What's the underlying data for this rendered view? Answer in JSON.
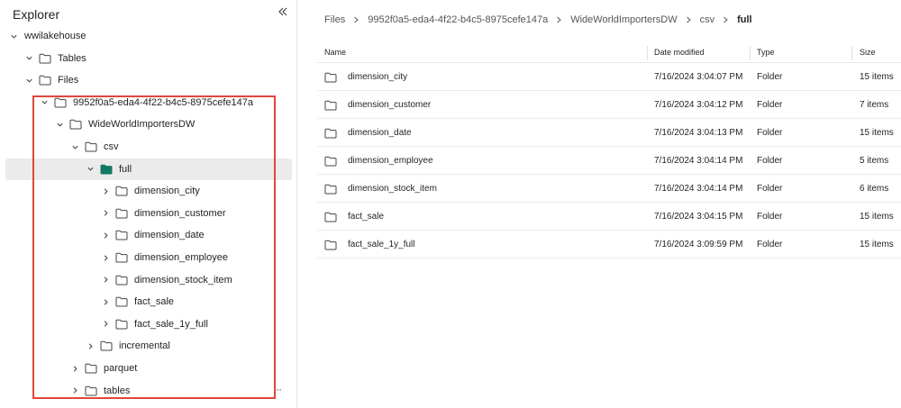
{
  "explorer": {
    "title": "Explorer",
    "tree": [
      {
        "label": "wwilakehouse",
        "depth": 0,
        "expanded": true,
        "folder": false
      },
      {
        "label": "Tables",
        "depth": 1,
        "expanded": true,
        "folder": true
      },
      {
        "label": "Files",
        "depth": 1,
        "expanded": true,
        "folder": true
      },
      {
        "label": "9952f0a5-eda4-4f22-b4c5-8975cefe147a",
        "depth": 2,
        "expanded": true,
        "folder": true
      },
      {
        "label": "WideWorldImportersDW",
        "depth": 3,
        "expanded": true,
        "folder": true
      },
      {
        "label": "csv",
        "depth": 4,
        "expanded": true,
        "folder": true
      },
      {
        "label": "full",
        "depth": 5,
        "expanded": true,
        "folder": true,
        "selected": true
      },
      {
        "label": "dimension_city",
        "depth": 6,
        "expanded": false,
        "folder": true
      },
      {
        "label": "dimension_customer",
        "depth": 6,
        "expanded": false,
        "folder": true
      },
      {
        "label": "dimension_date",
        "depth": 6,
        "expanded": false,
        "folder": true
      },
      {
        "label": "dimension_employee",
        "depth": 6,
        "expanded": false,
        "folder": true
      },
      {
        "label": "dimension_stock_item",
        "depth": 6,
        "expanded": false,
        "folder": true
      },
      {
        "label": "fact_sale",
        "depth": 6,
        "expanded": false,
        "folder": true
      },
      {
        "label": "fact_sale_1y_full",
        "depth": 6,
        "expanded": false,
        "folder": true
      },
      {
        "label": "incremental",
        "depth": 5,
        "expanded": false,
        "folder": true
      },
      {
        "label": "parquet",
        "depth": 4,
        "expanded": false,
        "folder": true
      },
      {
        "label": "tables",
        "depth": 4,
        "expanded": false,
        "folder": true
      }
    ],
    "more_label": "···"
  },
  "breadcrumb": [
    "Files",
    "9952f0a5-eda4-4f22-b4c5-8975cefe147a",
    "WideWorldImportersDW",
    "csv",
    "full"
  ],
  "table": {
    "headers": {
      "name": "Name",
      "date": "Date modified",
      "type": "Type",
      "size": "Size"
    },
    "rows": [
      {
        "name": "dimension_city",
        "date": "7/16/2024 3:04:07 PM",
        "type": "Folder",
        "size": "15 items"
      },
      {
        "name": "dimension_customer",
        "date": "7/16/2024 3:04:12 PM",
        "type": "Folder",
        "size": "7 items"
      },
      {
        "name": "dimension_date",
        "date": "7/16/2024 3:04:13 PM",
        "type": "Folder",
        "size": "15 items"
      },
      {
        "name": "dimension_employee",
        "date": "7/16/2024 3:04:14 PM",
        "type": "Folder",
        "size": "5 items"
      },
      {
        "name": "dimension_stock_item",
        "date": "7/16/2024 3:04:14 PM",
        "type": "Folder",
        "size": "6 items"
      },
      {
        "name": "fact_sale",
        "date": "7/16/2024 3:04:15 PM",
        "type": "Folder",
        "size": "15 items"
      },
      {
        "name": "fact_sale_1y_full",
        "date": "7/16/2024 3:09:59 PM",
        "type": "Folder",
        "size": "15 items"
      }
    ]
  },
  "colors": {
    "accent_folder": "#117865",
    "highlight_border": "#e0473a",
    "selected_row": "#ebebeb"
  },
  "icons": {
    "collapse": "double-chevron-left-icon",
    "folder": "folder-icon",
    "folder_open_filled": "folder-filled-icon",
    "chevron_down": "chevron-down-icon",
    "chevron_right": "chevron-right-icon"
  }
}
